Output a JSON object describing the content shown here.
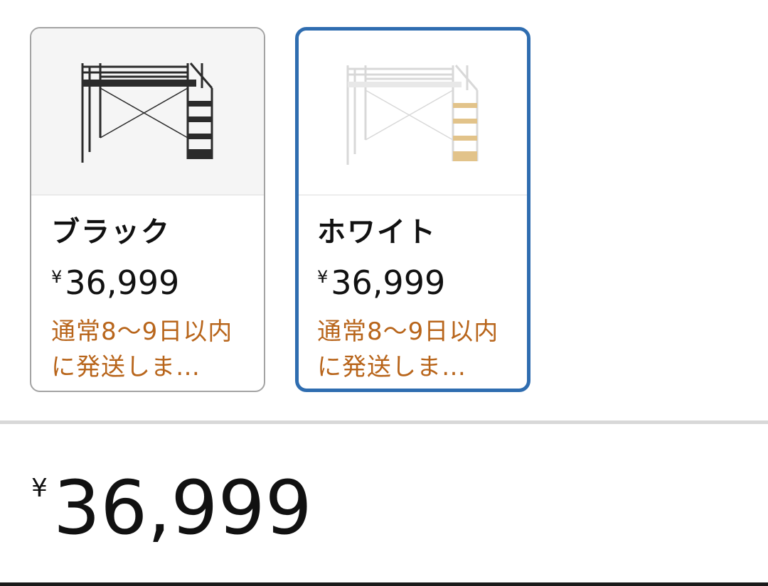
{
  "variants": [
    {
      "name": "ブラック",
      "currency": "¥",
      "price": "36,999",
      "delivery": "通常8〜9日以内に発送しま…",
      "selected": false,
      "frame_color": "#2b2b2b",
      "shelf_color": "#2b2b2b"
    },
    {
      "name": "ホワイト",
      "currency": "¥",
      "price": "36,999",
      "delivery": "通常8〜9日以内に発送しま…",
      "selected": true,
      "frame_color": "#e6e6e6",
      "shelf_color": "#e2c38a"
    }
  ],
  "main_price": {
    "currency": "¥",
    "amount": "36,999"
  },
  "colors": {
    "selected_border": "#2f6db0",
    "delivery_text": "#b8651b",
    "card_border": "#a3a3a3"
  }
}
